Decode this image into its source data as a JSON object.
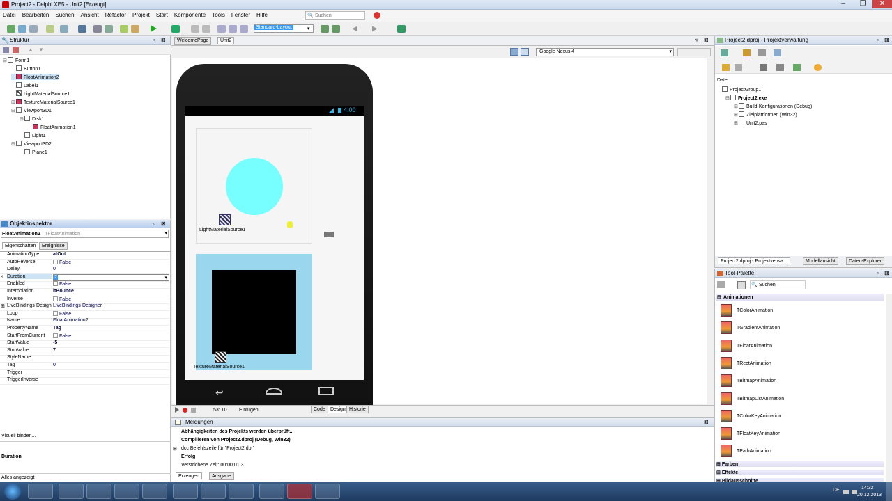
{
  "window": {
    "title": "Project2 - Delphi XE5 - Unit2 [Erzeugt]"
  },
  "menu": [
    "Datei",
    "Bearbeiten",
    "Suchen",
    "Ansicht",
    "Refactor",
    "Projekt",
    "Start",
    "Komponente",
    "Tools",
    "Fenster",
    "Hilfe"
  ],
  "search_placeholder": "Suchen",
  "layout_combo": "Standard-Layout",
  "structure": {
    "title": "Struktur",
    "items": [
      {
        "label": "Form1",
        "depth": 0,
        "expander": "⊟",
        "icon": "form"
      },
      {
        "label": "Button1",
        "depth": 1,
        "expander": "",
        "icon": "comp"
      },
      {
        "label": "FloatAnimation2",
        "depth": 1,
        "expander": "",
        "icon": "anim",
        "selected": true
      },
      {
        "label": "Label1",
        "depth": 1,
        "expander": "",
        "icon": "comp"
      },
      {
        "label": "LightMaterialSource1",
        "depth": 1,
        "expander": "",
        "icon": "tex"
      },
      {
        "label": "TextureMaterialSource1",
        "depth": 1,
        "expander": "⊞",
        "icon": "anim"
      },
      {
        "label": "Viewport3D1",
        "depth": 1,
        "expander": "⊟",
        "icon": "comp"
      },
      {
        "label": "Disk1",
        "depth": 2,
        "expander": "⊟",
        "icon": "comp"
      },
      {
        "label": "FloatAnimation1",
        "depth": 3,
        "expander": "",
        "icon": "anim"
      },
      {
        "label": "Light1",
        "depth": 2,
        "expander": "",
        "icon": "comp"
      },
      {
        "label": "Viewport3D2",
        "depth": 1,
        "expander": "⊟",
        "icon": "comp"
      },
      {
        "label": "Plane1",
        "depth": 2,
        "expander": "",
        "icon": "comp"
      }
    ]
  },
  "oi": {
    "title": "Objektinspektor",
    "object": "FloatAnimation2",
    "type": "TFloatAnimation",
    "tabs": [
      "Eigenschaften",
      "Ereignisse"
    ],
    "rows": [
      {
        "name": "AnimationType",
        "value": "atOut",
        "bold": true
      },
      {
        "name": "AutoReverse",
        "value": "False",
        "check": true
      },
      {
        "name": "Delay",
        "value": "0"
      },
      {
        "name": "Duration",
        "value": "2",
        "selected": true
      },
      {
        "name": "Enabled",
        "value": "False",
        "check": true
      },
      {
        "name": "Interpolation",
        "value": "itBounce",
        "bold": true
      },
      {
        "name": "Inverse",
        "value": "False",
        "check": true
      },
      {
        "name": "LiveBindings-Design",
        "value": "LiveBindings-Designer",
        "expander": "⊞"
      },
      {
        "name": "Loop",
        "value": "False",
        "check": true
      },
      {
        "name": "Name",
        "value": "FloatAnimation2"
      },
      {
        "name": "PropertyName",
        "value": "Tag",
        "bold": true
      },
      {
        "name": "StartFromCurrent",
        "value": "False",
        "check": true
      },
      {
        "name": "StartValue",
        "value": "-5",
        "bold": true
      },
      {
        "name": "StopValue",
        "value": "7",
        "bold": true
      },
      {
        "name": "StyleName",
        "value": ""
      },
      {
        "name": "Tag",
        "value": "0"
      },
      {
        "name": "Trigger",
        "value": ""
      },
      {
        "name": "TriggerInverse",
        "value": ""
      }
    ],
    "footer_link": "Visuell binden...",
    "desc_title": "Duration",
    "status": "Alles angezeigt"
  },
  "editor": {
    "tabs": [
      "WelcomePage",
      "Unit2"
    ],
    "device": "Google Nexus 4",
    "clock": "4:00",
    "light_label": "LightMaterialSource1",
    "texture_label": "TextureMaterialSource1"
  },
  "statusbar": {
    "position": "53: 10",
    "mode": "Einfügen",
    "tabs": [
      "Code",
      "Design",
      "Historie"
    ]
  },
  "messages": {
    "title": "Meldungen",
    "lines": [
      {
        "text": "Abhängigkeiten des Projekts werden überprüft...",
        "bold": true
      },
      {
        "text": "Compilieren von Project2.dproj (Debug, Win32)",
        "bold": true
      },
      {
        "text": "dcc Befehlszeile für \"Project2.dpr\"",
        "bold": false,
        "expander": "⊞"
      },
      {
        "text": "Erfolg",
        "bold": true
      },
      {
        "text": "Verstrichene Zeit: 00:00:01.3",
        "bold": false
      }
    ],
    "tabs": [
      "Erzeugen",
      "Ausgabe"
    ]
  },
  "project": {
    "title": "Project2.dproj - Projektverwaltung",
    "section": "Datei",
    "items": [
      {
        "label": "ProjectGroup1",
        "depth": 0
      },
      {
        "label": "Project2.exe",
        "depth": 1,
        "bold": true,
        "expander": "⊟"
      },
      {
        "label": "Build-Konfigurationen (Debug)",
        "depth": 2,
        "expander": "⊞"
      },
      {
        "label": "Zielplattformen (Win32)",
        "depth": 2,
        "expander": "⊞"
      },
      {
        "label": "Unit2.pas",
        "depth": 2,
        "expander": "⊞"
      }
    ],
    "tabs": [
      "Project2.dproj - Projektverwa...",
      "Modellansicht",
      "Daten-Explorer"
    ]
  },
  "palette": {
    "title": "Tool-Palette",
    "search": "Suchen",
    "category": "Animationen",
    "items": [
      "TColorAnimation",
      "TGradientAnimation",
      "TFloatAnimation",
      "TRectAnimation",
      "TBitmapAnimation",
      "TBitmapListAnimation",
      "TColorKeyAnimation",
      "TFloatKeyAnimation",
      "TPathAnimation"
    ],
    "more": [
      "Farben",
      "Effekte",
      "Bildausschnitte"
    ]
  },
  "tray": {
    "lang": "DE",
    "time": "14:32",
    "date": "20.12.2013"
  }
}
